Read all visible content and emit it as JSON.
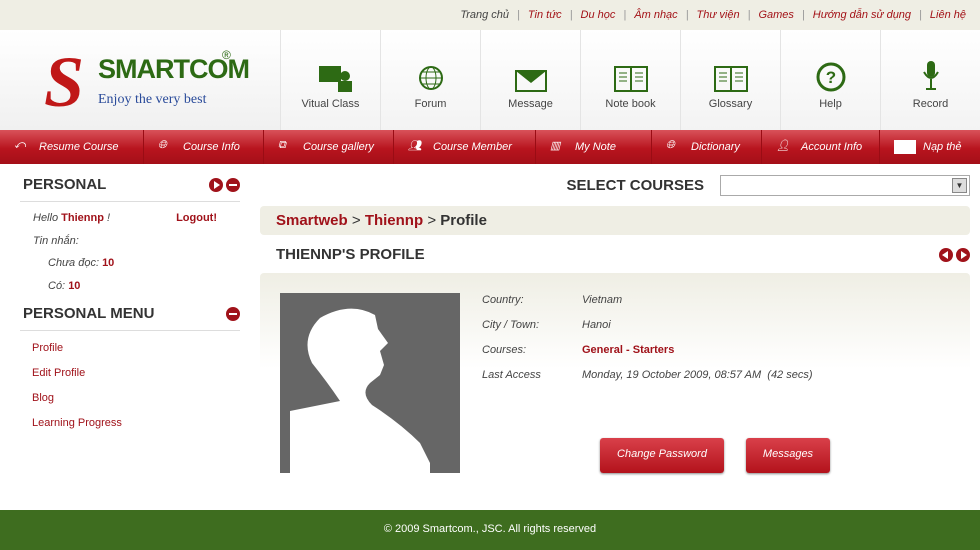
{
  "topnav": [
    "Trang chủ",
    "Tin tức",
    "Du học",
    "Âm nhạc",
    "Thư viện",
    "Games",
    "Hướng dẫn sử dụng",
    "Liên hệ"
  ],
  "logo": {
    "name": "SMARTCOM",
    "reg": "®",
    "tagline": "Enjoy the very best"
  },
  "header_buttons": [
    {
      "label": "Vitual Class",
      "icon": "virtual-class-icon"
    },
    {
      "label": "Forum",
      "icon": "globe-icon"
    },
    {
      "label": "Message",
      "icon": "envelope-icon"
    },
    {
      "label": "Note book",
      "icon": "book-icon"
    },
    {
      "label": "Glossary",
      "icon": "book-icon"
    },
    {
      "label": "Help",
      "icon": "question-icon"
    },
    {
      "label": "Record",
      "icon": "microphone-icon"
    }
  ],
  "redbar": [
    "Resume Course",
    "Course Info",
    "Course gallery",
    "Course Member",
    "My Note",
    "Dictionary",
    "Account Info",
    "Nạp thẻ"
  ],
  "personal": {
    "title": "PERSONAL",
    "hello": "Hello",
    "user": "Thiennp",
    "excl": "!",
    "logout": "Logout!",
    "messages": "Tin nhắn:",
    "unread_label": "Chưa đọc:",
    "unread": "10",
    "have_label": "Có:",
    "have": "10"
  },
  "personal_menu": {
    "title": "PERSONAL MENU",
    "items": [
      "Profile",
      "Edit Profile",
      "Blog",
      "Learning Progress"
    ]
  },
  "select_courses": {
    "label": "SELECT COURSES",
    "value": ""
  },
  "breadcrumb": {
    "a": "Smartweb",
    "b": "Thiennp",
    "c": "Profile",
    "sep": ">"
  },
  "profile": {
    "title": "THIENNP'S PROFILE",
    "fields": [
      {
        "k": "Country:",
        "v": "Vietnam"
      },
      {
        "k": "City / Town:",
        "v": "Hanoi"
      },
      {
        "k": "Courses:",
        "v": "General - Starters"
      },
      {
        "k": "Last Access",
        "v": "Monday, 19 October 2009, 08:57 AM  (42 secs)"
      }
    ],
    "change_password": "Change Password",
    "messages": "Messages"
  },
  "footer": "© 2009 Smartcom., JSC. All rights reserved"
}
